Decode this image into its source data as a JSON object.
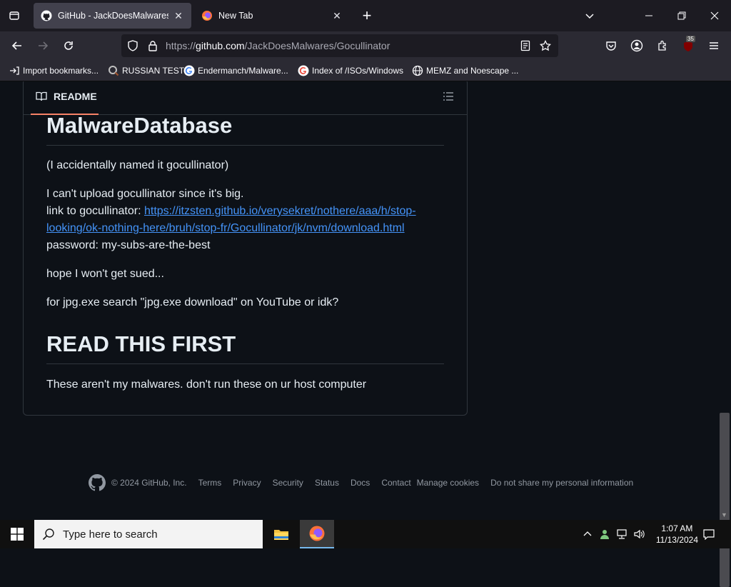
{
  "browser": {
    "tabs": [
      {
        "title": "GitHub - JackDoesMalwares/Gocullinator",
        "active": true
      },
      {
        "title": "New Tab",
        "active": false
      }
    ],
    "url_prefix": "https://",
    "url_host": "github.com",
    "url_path": "/JackDoesMalwares/Gocullinator",
    "extension_badge": "35",
    "bookmarks": [
      {
        "label": "Import bookmarks...",
        "icon": "import-icon"
      },
      {
        "label": "RUSSIAN TEST",
        "icon": "search-circle-icon"
      },
      {
        "label": "Endermanch/Malware...",
        "icon": "google-icon"
      },
      {
        "label": "Index of /ISOs/Windows",
        "icon": "google-icon"
      },
      {
        "label": "MEMZ and Noescape ...",
        "icon": "globe-icon"
      }
    ]
  },
  "readme": {
    "tab_label": "README",
    "h1_title": "MalwareDatabase",
    "p1": "(I accidentally named it gocullinator)",
    "p2_line1": "I can't upload gocullinator since it's big.",
    "p2_line2_prefix": "link to gocullinator: ",
    "link_line1": "https://itzsten.github.io/verysekret/nothere/aaa/h/stop-",
    "link_line2": "looking/ok-nothing-here/bruh/stop-fr/Gocullinator/jk/nvm/download.html",
    "p2_line3": "password: my-subs-are-the-best",
    "p3": "hope I won't get sued...",
    "p4": "for jpg.exe search \"jpg.exe download\" on YouTube or idk?",
    "h1_read": "READ THIS FIRST",
    "p5": "These aren't my malwares. don't run these on ur host computer"
  },
  "footer": {
    "copyright": "© 2024 GitHub, Inc.",
    "links": [
      "Terms",
      "Privacy",
      "Security",
      "Status",
      "Docs",
      "Contact"
    ],
    "manage_cookies": "Manage cookies",
    "do_not_share": "Do not share my personal information"
  },
  "taskbar": {
    "search_placeholder": "Type here to search",
    "time": "1:07 AM",
    "date": "11/13/2024"
  },
  "colors": {
    "page_bg": "#0d1117",
    "link": "#4493f8",
    "tab_underline": "#f78166",
    "firefox_chrome": "#2b2a33"
  }
}
